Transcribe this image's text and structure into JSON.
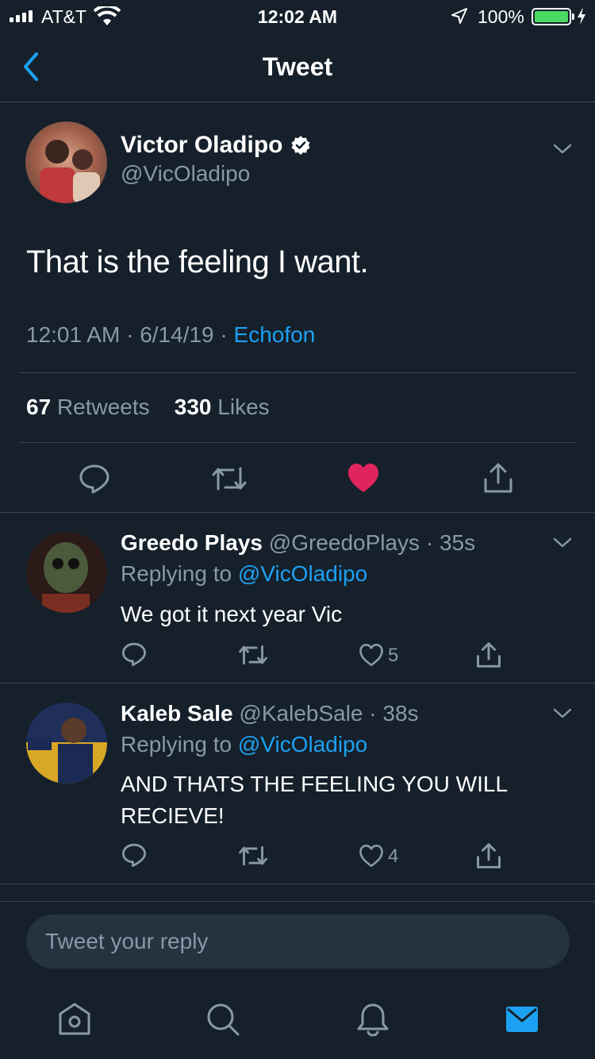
{
  "status_bar": {
    "carrier": "AT&T",
    "time": "12:02 AM",
    "battery": "100%"
  },
  "header": {
    "title": "Tweet"
  },
  "main_tweet": {
    "name": "Victor Oladipo",
    "handle": "@VicOladipo",
    "text": "That is the feeling I want.",
    "time": "12:01 AM",
    "date": "6/14/19",
    "source": "Echofon",
    "separator": "·",
    "retweets_count": "67",
    "retweets_label": "Retweets",
    "likes_count": "330",
    "likes_label": "Likes",
    "liked": true
  },
  "replies": [
    {
      "name": "Greedo Plays",
      "handle": "@GreedoPlays",
      "age": "35s",
      "replying_prefix": "Replying to",
      "replying_to": "@VicOladipo",
      "text": "We got it next year Vic",
      "likes": "5"
    },
    {
      "name": "Kaleb Sale",
      "handle": "@KalebSale",
      "age": "38s",
      "replying_prefix": "Replying to",
      "replying_to": "@VicOladipo",
      "text": "AND THATS THE FEELING YOU WILL RECIEVE!",
      "likes": "4"
    }
  ],
  "compose": {
    "placeholder": "Tweet your reply"
  },
  "tab_bar": {
    "items": [
      "home-icon",
      "search-icon",
      "notifications-icon",
      "messages-icon"
    ]
  },
  "colors": {
    "background": "#15202b",
    "accent": "#1da1f2",
    "like": "#e0245e",
    "muted": "#8899a6"
  }
}
